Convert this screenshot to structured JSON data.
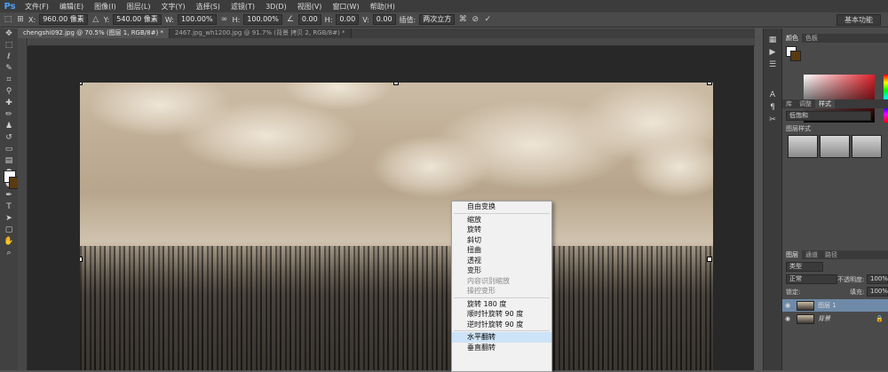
{
  "app": {
    "logo": "Ps"
  },
  "menu": [
    "文件(F)",
    "编辑(E)",
    "图像(I)",
    "图层(L)",
    "文字(Y)",
    "选择(S)",
    "滤镜(T)",
    "3D(D)",
    "视图(V)",
    "窗口(W)",
    "帮助(H)"
  ],
  "options": {
    "x_label": "X:",
    "x_value": "960.00 像素",
    "y_label": "Y:",
    "y_value": "540.00 像素",
    "w_label": "W:",
    "w_value": "100.00%",
    "h_label": "H:",
    "h_value": "100.00%",
    "angle_value": "0.00",
    "hskew_label": "H:",
    "hskew_value": "0.00",
    "vskew_label": "V:",
    "vskew_value": "0.00",
    "interp_label": "插值:",
    "interp_value": "两次立方",
    "workspace": "基本功能"
  },
  "tabs": [
    {
      "label": "chengshi092.jpg @ 70.5% (图层 1, RGB/8#) *",
      "active": true
    },
    {
      "label": "2467.jpg_wh1200.jpg @ 91.7% (背景 拷贝 2, RGB/8#) *",
      "active": false
    }
  ],
  "context_menu": {
    "groups": [
      [
        {
          "label": "自由变换",
          "disabled": false,
          "hover": false
        }
      ],
      [
        {
          "label": "缩放",
          "disabled": false,
          "hover": false
        },
        {
          "label": "旋转",
          "disabled": false,
          "hover": false
        },
        {
          "label": "斜切",
          "disabled": false,
          "hover": false
        },
        {
          "label": "扭曲",
          "disabled": false,
          "hover": false
        },
        {
          "label": "透视",
          "disabled": false,
          "hover": false
        },
        {
          "label": "变形",
          "disabled": false,
          "hover": false
        },
        {
          "label": "内容识别缩放",
          "disabled": true,
          "hover": false
        },
        {
          "label": "操控变形",
          "disabled": true,
          "hover": false
        }
      ],
      [
        {
          "label": "旋转 180 度",
          "disabled": false,
          "hover": false
        },
        {
          "label": "顺时针旋转 90 度",
          "disabled": false,
          "hover": false
        },
        {
          "label": "逆时针旋转 90 度",
          "disabled": false,
          "hover": false
        }
      ],
      [
        {
          "label": "水平翻转",
          "disabled": false,
          "hover": true
        },
        {
          "label": "垂直翻转",
          "disabled": false,
          "hover": false
        }
      ]
    ]
  },
  "panels": {
    "color_tabs": [
      "颜色",
      "色板"
    ],
    "adjust_tabs": [
      "库",
      "调整",
      "样式"
    ],
    "adjust_dropdown": "低饱和",
    "styles_label": "图层样式",
    "layers_tabs": [
      "图层",
      "通道",
      "路径"
    ],
    "filter_kind": "类型",
    "blend_mode": "正常",
    "opacity_label": "不透明度:",
    "opacity_value": "100%",
    "lock_label": "锁定:",
    "fill_label": "填充:",
    "fill_value": "100%",
    "layers": [
      {
        "name": "图层 1",
        "active": true
      },
      {
        "name": "背景",
        "active": false
      }
    ]
  },
  "colors": {
    "foreground": "#ffffff",
    "background": "#5b3a12",
    "accent": "#4aa3ff"
  }
}
